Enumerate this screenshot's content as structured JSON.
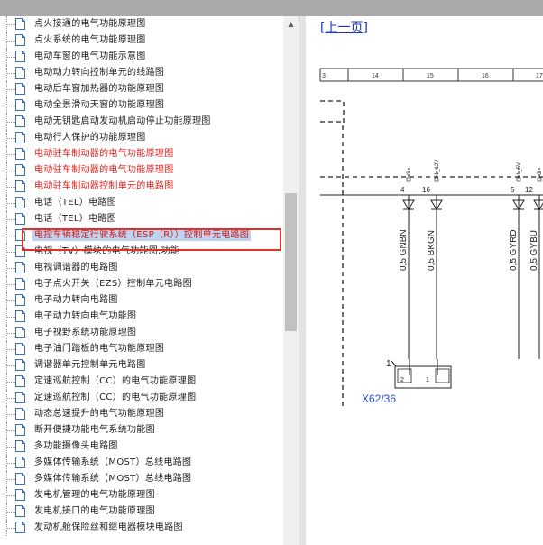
{
  "toc": {
    "items": [
      {
        "label": "点火接通的电气功能原理图",
        "style": "normal"
      },
      {
        "label": "点火系统的电气功能原理图",
        "style": "normal"
      },
      {
        "label": "电动车窗的电气功能示意图",
        "style": "normal"
      },
      {
        "label": "电动动力转向控制单元的线路图",
        "style": "normal"
      },
      {
        "label": "电动后车窗加热器的功能原理图",
        "style": "normal"
      },
      {
        "label": "电动全景滑动天窗的功能原理图",
        "style": "normal"
      },
      {
        "label": "电动无钥匙启动发动机启动停止功能原理图",
        "style": "normal"
      },
      {
        "label": "电动行人保护的功能原理图",
        "style": "normal"
      },
      {
        "label": "电动驻车制动器的电气功能原理图",
        "style": "red"
      },
      {
        "label": "电动驻车制动器的电气功能原理图",
        "style": "red"
      },
      {
        "label": "电动驻车制动器控制单元的电路图",
        "style": "red"
      },
      {
        "label": "电话（TEL）电路图",
        "style": "normal"
      },
      {
        "label": "电话（TEL）电路图",
        "style": "normal"
      },
      {
        "label": "电控车辆稳定行驶系统（ESP（R））控制单元电路图",
        "style": "selected"
      },
      {
        "label": "电视（TV）模块的电气功能图,功能",
        "style": "normal"
      },
      {
        "label": "电视调谐器的电路图",
        "style": "normal"
      },
      {
        "label": "电子点火开关（EZS）控制单元电路图",
        "style": "normal"
      },
      {
        "label": "电子动力转向电路图",
        "style": "normal"
      },
      {
        "label": "电子动力转向电气功能图",
        "style": "normal"
      },
      {
        "label": "电子视野系统功能原理图",
        "style": "normal"
      },
      {
        "label": "电子油门踏板的电气功能原理图",
        "style": "normal"
      },
      {
        "label": "调谐器单元控制单元电路图",
        "style": "normal"
      },
      {
        "label": "定速巡航控制（CC）的电气功能原理图",
        "style": "normal"
      },
      {
        "label": "定速巡航控制（CC）的电气功能原理图",
        "style": "normal"
      },
      {
        "label": "动态总速提升的电气功能原理图",
        "style": "normal"
      },
      {
        "label": "断开便捷功能电气系统功能图",
        "style": "normal"
      },
      {
        "label": "多功能摄像头电路图",
        "style": "normal"
      },
      {
        "label": "多媒体传输系统（MOST）总线电路图",
        "style": "normal"
      },
      {
        "label": "多媒体传输系统（MOST）总线电路图",
        "style": "normal"
      },
      {
        "label": "发电机管理的电气功能原理图",
        "style": "normal"
      },
      {
        "label": "发电机接口的电气功能原理图",
        "style": "normal"
      },
      {
        "label": "发动机舱保险丝和继电器模块电路图",
        "style": "normal"
      }
    ]
  },
  "viewer": {
    "prev_link": "[上一页]",
    "ruler": [
      "3",
      "14",
      "15",
      "16",
      "17"
    ],
    "pins": [
      {
        "num": "4",
        "wire": "0,5 GNBN",
        "top": "G"
      },
      {
        "num": "16",
        "wire": "0,5 BKGN",
        "top": "1_12V"
      },
      {
        "num": "5",
        "wire": "0,5 GYRD",
        "top": "1_5V"
      },
      {
        "num": "12",
        "wire": "0,5 GYBU",
        "top": "G"
      }
    ],
    "connector": {
      "name": "X62/36",
      "pin_a": "1",
      "inner_left": "2",
      "inner_right": "1"
    }
  },
  "colors": {
    "selected_border": "#e0302a",
    "red_text": "#e0201c",
    "link": "#1a33cc",
    "connector_label": "#2b4fc4"
  }
}
